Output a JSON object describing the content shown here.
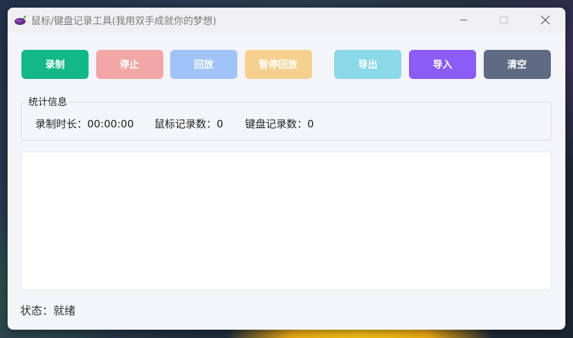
{
  "window": {
    "title": "鼠标/键盘记录工具(我用双手成就你的梦想)",
    "app_icon": "eggplant-icon",
    "controls": [
      "minimize-icon",
      "maximize-icon",
      "close-icon"
    ]
  },
  "toolbar": {
    "buttons": [
      {
        "label": "录制",
        "color": "#12b886"
      },
      {
        "label": "停止",
        "color": "#f2a6a6"
      },
      {
        "label": "回放",
        "color": "#a0c4f8"
      },
      {
        "label": "暂停回放",
        "color": "#f5d08e"
      },
      {
        "label": "导出",
        "color": "#8ad8e8"
      },
      {
        "label": "导入",
        "color": "#8b5cf6"
      },
      {
        "label": "清空",
        "color": "#5f6b82"
      }
    ]
  },
  "stats": {
    "legend": "统计信息",
    "duration": "录制时长：00:00:00",
    "mouse_count": "鼠标记录数：0",
    "keyboard_count": "键盘记录数：0"
  },
  "log": {
    "content": ""
  },
  "status": {
    "text": "状态：就绪"
  }
}
